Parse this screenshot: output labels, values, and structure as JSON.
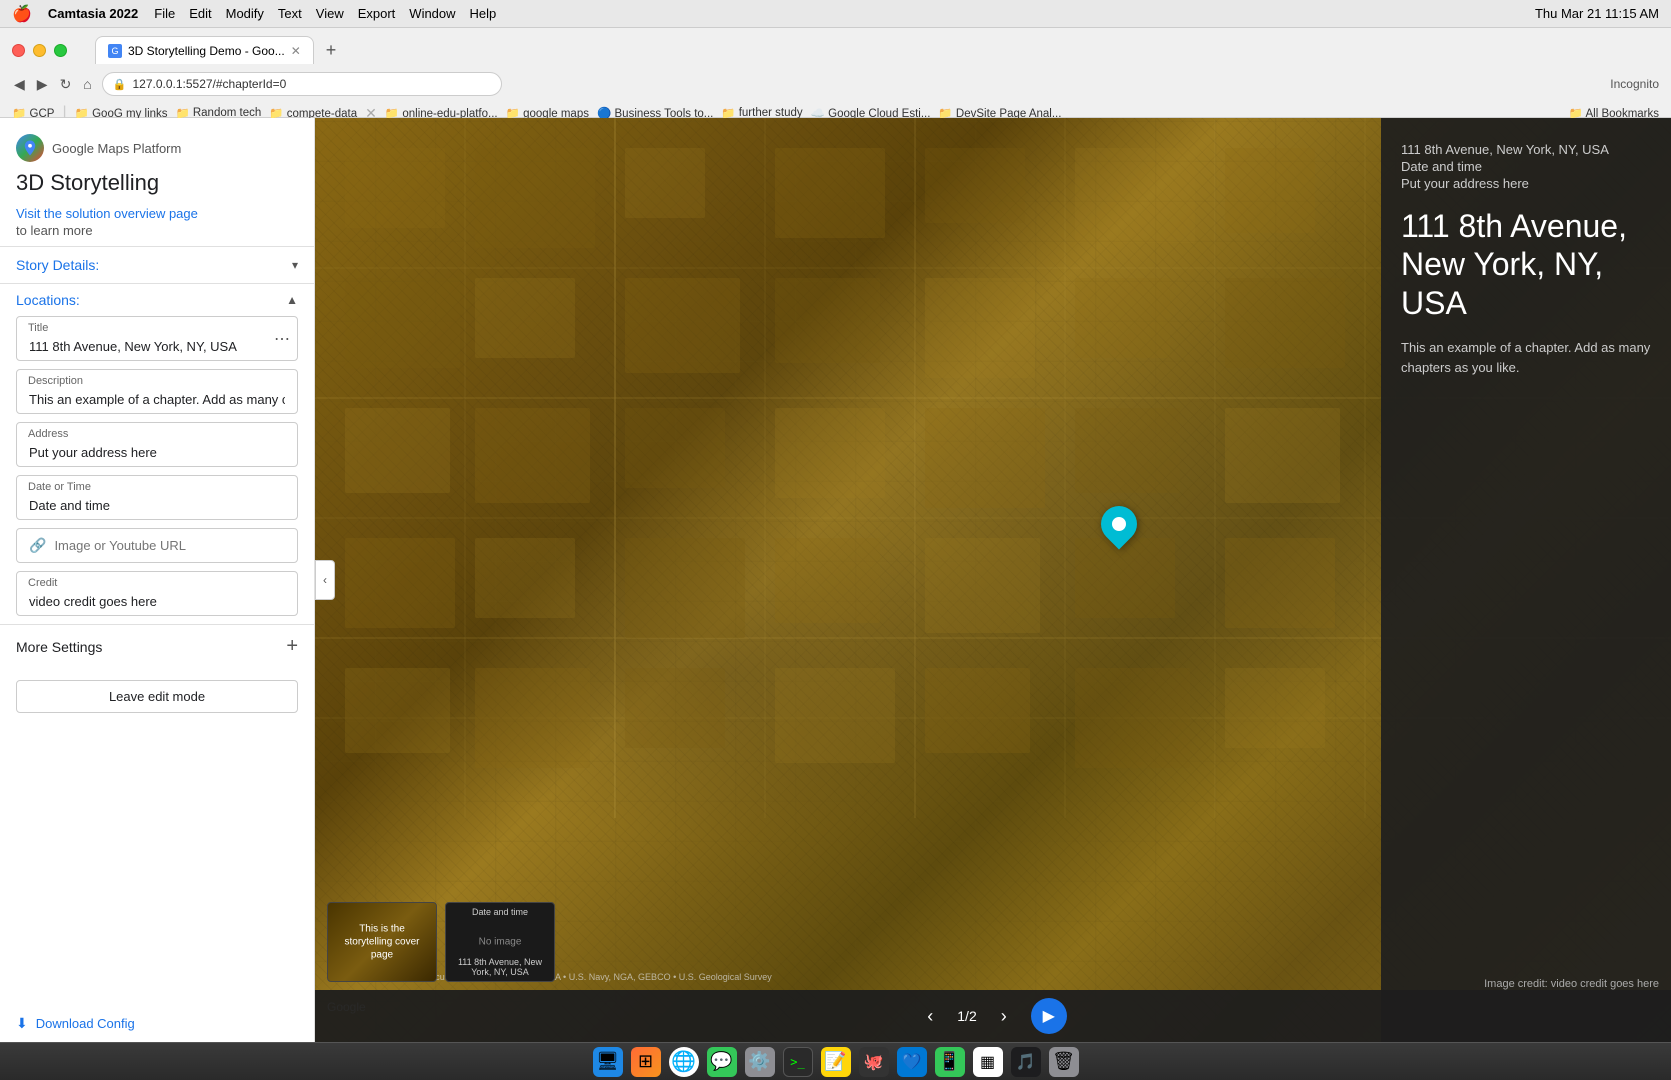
{
  "menubar": {
    "apple": "🍎",
    "app_name": "Camtasia 2022",
    "menus": [
      "File",
      "Edit",
      "Modify",
      "Text",
      "View",
      "Export",
      "Window",
      "Help"
    ],
    "datetime": "Thu Mar 21  11:15 AM"
  },
  "browser": {
    "tab_title": "3D Storytelling Demo - Goo...",
    "url": "127.0.0.1:5527/#chapterId=0",
    "new_tab_symbol": "+"
  },
  "bookmarks": [
    {
      "label": "GCP",
      "icon": "📁"
    },
    {
      "label": "GooG my links",
      "icon": "📁"
    },
    {
      "label": "Random tech",
      "icon": "📁"
    },
    {
      "label": "compete-data",
      "icon": "📁"
    },
    {
      "label": "online-edu-platfo...",
      "icon": "📁"
    },
    {
      "label": "google maps",
      "icon": "📁"
    },
    {
      "label": "Business Tools to...",
      "icon": "🔵"
    },
    {
      "label": "further study",
      "icon": "📁"
    },
    {
      "label": "Google Cloud Esti...",
      "icon": "☁️"
    },
    {
      "label": "DevSite Page Anal...",
      "icon": "📁"
    },
    {
      "label": "All Bookmarks",
      "icon": "📁"
    }
  ],
  "left_panel": {
    "maps_platform_label": "Google Maps Platform",
    "app_title": "3D Storytelling",
    "visit_link_text": "Visit the solution overview page",
    "learn_more": "to learn more",
    "story_details_label": "Story Details:",
    "locations_label": "Locations:",
    "form": {
      "title_label": "Title",
      "title_value": "111 8th Avenue, New York, NY, USA",
      "description_label": "Description",
      "description_value": "This an example of a chapter. Add as many chapte",
      "address_label": "Address",
      "address_value": "Put your address here",
      "date_time_label": "Date or Time",
      "date_time_value": "Date and time",
      "url_label": "Image or Youtube URL",
      "url_placeholder": "Image or Youtube URL",
      "credit_label": "Credit",
      "credit_value": "video credit goes here"
    },
    "more_settings_label": "More Settings",
    "leave_edit_label": "Leave edit mode",
    "download_config_label": "Download Config"
  },
  "info_panel": {
    "address_small": "111 8th Avenue, New York, NY, USA",
    "datetime": "Date and time",
    "address_small2": "Put your address here",
    "title": "111 8th Avenue, New York, NY, USA",
    "description": "This an example of a chapter. Add as many chapters as you like.",
    "image_credit": "Image credit: video credit goes here"
  },
  "navigation": {
    "page_current": "1",
    "page_total": "2",
    "page_display": "1/2"
  },
  "chapter_thumbnails": [
    {
      "text": "This is the storytelling cover page",
      "type": "cover"
    },
    {
      "date_label": "Date and time",
      "no_image": "No image",
      "address": "111 8th Avenue, New York, NY, USA",
      "type": "chapter"
    }
  ],
  "map": {
    "attribution": "Google • Landsat / Copernicus • IBCAO • Data SIO, NOAA • U.S. Navy, NGA, GEBCO • U.S. Geological Survey"
  },
  "dock": {
    "icons": [
      "🍎",
      "🚀",
      "🌐",
      "💬",
      "⚙️",
      ">_",
      "📝",
      "🐙",
      "💙",
      "📱",
      "▦",
      "🎵",
      "🗑️"
    ]
  }
}
